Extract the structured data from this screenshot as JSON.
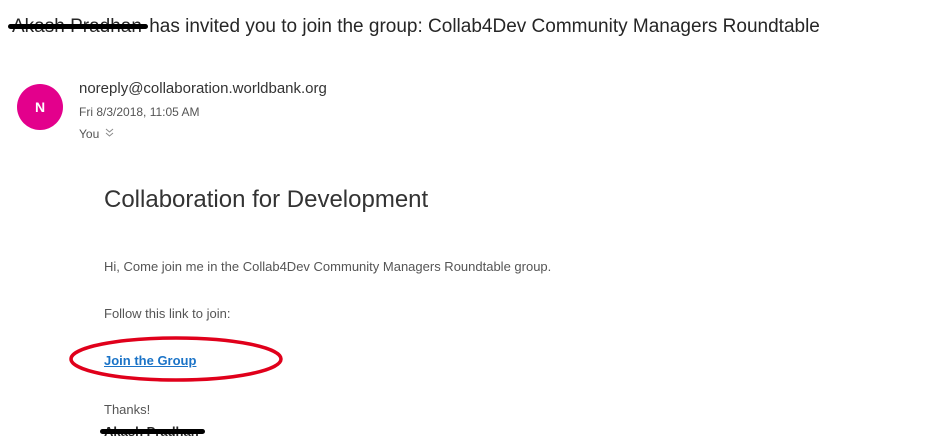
{
  "subject": {
    "redacted_name": "Akash Pradhan",
    "text": "has invited you to join the group: Collab4Dev Community Managers Roundtable"
  },
  "sender": {
    "avatar_initial": "N",
    "avatar_color": "#e3008c",
    "email": "noreply@collaboration.worldbank.org",
    "date": "Fri 8/3/2018, 11:05 AM",
    "to": "You",
    "expand_icon": "chevron-double-down-icon"
  },
  "body": {
    "title": "Collaboration for Development",
    "greeting": "Hi, Come join me in the Collab4Dev Community Managers Roundtable group.",
    "follow_text": "Follow this link to join:",
    "link_label": "Join the Group",
    "link_color": "#1a73c7",
    "annotation_color": "#e0001b",
    "thanks": "Thanks!",
    "signature_redacted": "Akash Pradhan"
  }
}
